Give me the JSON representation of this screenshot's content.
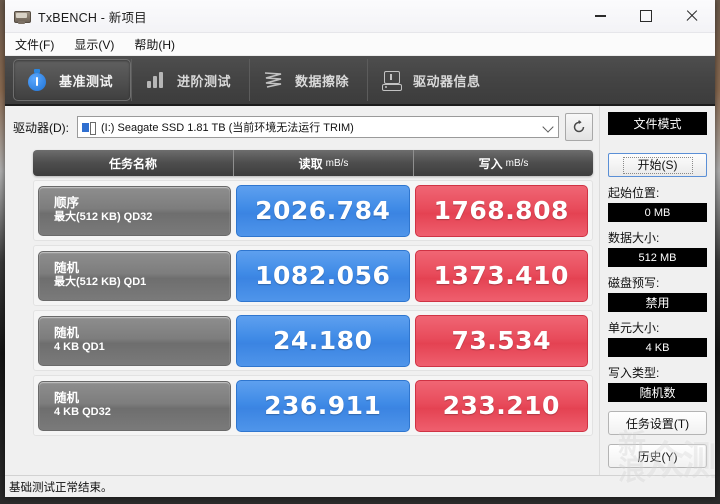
{
  "window": {
    "title": "TxBENCH - 新项目",
    "icon": "app-icon",
    "controls": {
      "minimize": "—",
      "maximize": "□",
      "close": "✕"
    }
  },
  "menubar": {
    "items": [
      {
        "label": "文件(F)",
        "accel": "F"
      },
      {
        "label": "显示(V)",
        "accel": "V"
      },
      {
        "label": "帮助(H)",
        "accel": "H"
      }
    ]
  },
  "toolbar": {
    "tabs": [
      {
        "label": "基准测试",
        "icon": "stopwatch-icon",
        "active": true
      },
      {
        "label": "进阶测试",
        "icon": "bar-chart-icon",
        "active": false
      },
      {
        "label": "数据擦除",
        "icon": "erase-icon",
        "active": false
      },
      {
        "label": "驱动器信息",
        "icon": "drive-info-icon",
        "active": false
      }
    ]
  },
  "drive": {
    "label": "驱动器(D):",
    "selected": "(I:) Seagate SSD  1.81 TB (当前环境无法运行 TRIM)",
    "refresh_icon": "refresh-icon"
  },
  "table": {
    "headers": {
      "name": "任务名称",
      "read": "读取",
      "read_unit": "mB/s",
      "write": "写入",
      "write_unit": "mB/s"
    },
    "rows": [
      {
        "name_line1": "顺序",
        "name_line2": "最大(512 KB) QD32",
        "read": "2026.784",
        "write": "1768.808"
      },
      {
        "name_line1": "随机",
        "name_line2": "最大(512 KB) QD1",
        "read": "1082.056",
        "write": "1373.410"
      },
      {
        "name_line1": "随机",
        "name_line2": "4 KB QD1",
        "read": "24.180",
        "write": "73.534"
      },
      {
        "name_line1": "随机",
        "name_line2": "4 KB QD32",
        "read": "236.911",
        "write": "233.210"
      }
    ]
  },
  "sidebar": {
    "mode": "文件模式",
    "start_button": "开始(S)",
    "fields": [
      {
        "label": "起始位置:",
        "value": "0 MB"
      },
      {
        "label": "数据大小:",
        "value": "512 MB"
      },
      {
        "label": "磁盘预写:",
        "value": "禁用"
      },
      {
        "label": "单元大小:",
        "value": "4 KB"
      },
      {
        "label": "写入类型:",
        "value": "随机数"
      }
    ],
    "task_settings_button": "任务设置(T)",
    "history_button": "历史(Y)"
  },
  "watermark": {
    "line1": "新浪",
    "line2": "众测"
  },
  "statusbar": {
    "text": "基础测试正常结束。"
  },
  "colors": {
    "read_pill": "#3f8ae6",
    "write_pill": "#e84b5b",
    "name_pill": "#7d7d7d",
    "toolbar_bg": "#444444",
    "window_bg": "#f0f0f0",
    "field_bg": "#000000"
  }
}
